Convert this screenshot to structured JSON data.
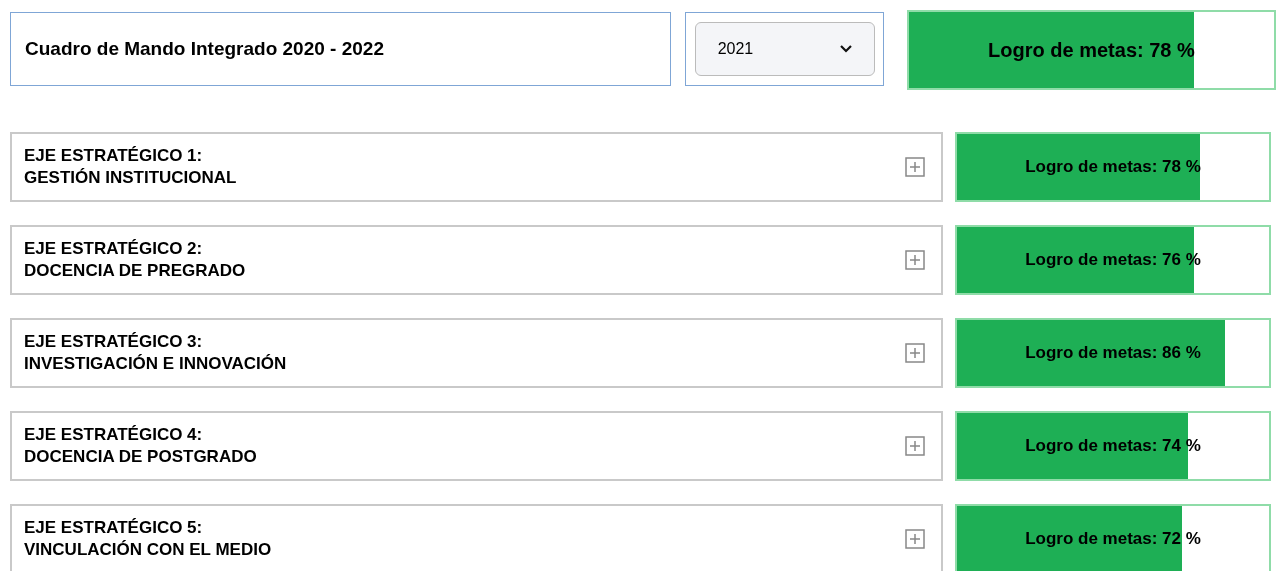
{
  "header": {
    "title": "Cuadro de Mando Integrado 2020 - 2022",
    "year_select": {
      "value": "2021"
    },
    "progress": {
      "label": "Logro de metas: 78 %",
      "level": 0.78
    }
  },
  "axes": [
    {
      "title": "EJE ESTRATÉGICO 1:",
      "subtitle": "GESTIÓN INSTITUCIONAL",
      "expanded": false,
      "progress": {
        "label": "Logro de metas: 78 %",
        "level": 0.78
      }
    },
    {
      "title": "EJE ESTRATÉGICO 2:",
      "subtitle": "DOCENCIA DE PREGRADO",
      "expanded": false,
      "progress": {
        "label": "Logro de metas: 76 %",
        "level": 0.76
      }
    },
    {
      "title": "EJE ESTRATÉGICO 3:",
      "subtitle": "INVESTIGACIÓN E INNOVACIÓN",
      "expanded": false,
      "progress": {
        "label": "Logro de metas: 86 %",
        "level": 0.86
      }
    },
    {
      "title": "EJE ESTRATÉGICO 4:",
      "subtitle": "DOCENCIA DE POSTGRADO",
      "expanded": false,
      "progress": {
        "label": "Logro de metas: 74 %",
        "level": 0.74
      }
    },
    {
      "title": "EJE ESTRATÉGICO 5:",
      "subtitle": "VINCULACIÓN CON EL MEDIO",
      "expanded": false,
      "progress": {
        "label": "Logro de metas: 72 %",
        "level": 0.72
      }
    }
  ]
}
